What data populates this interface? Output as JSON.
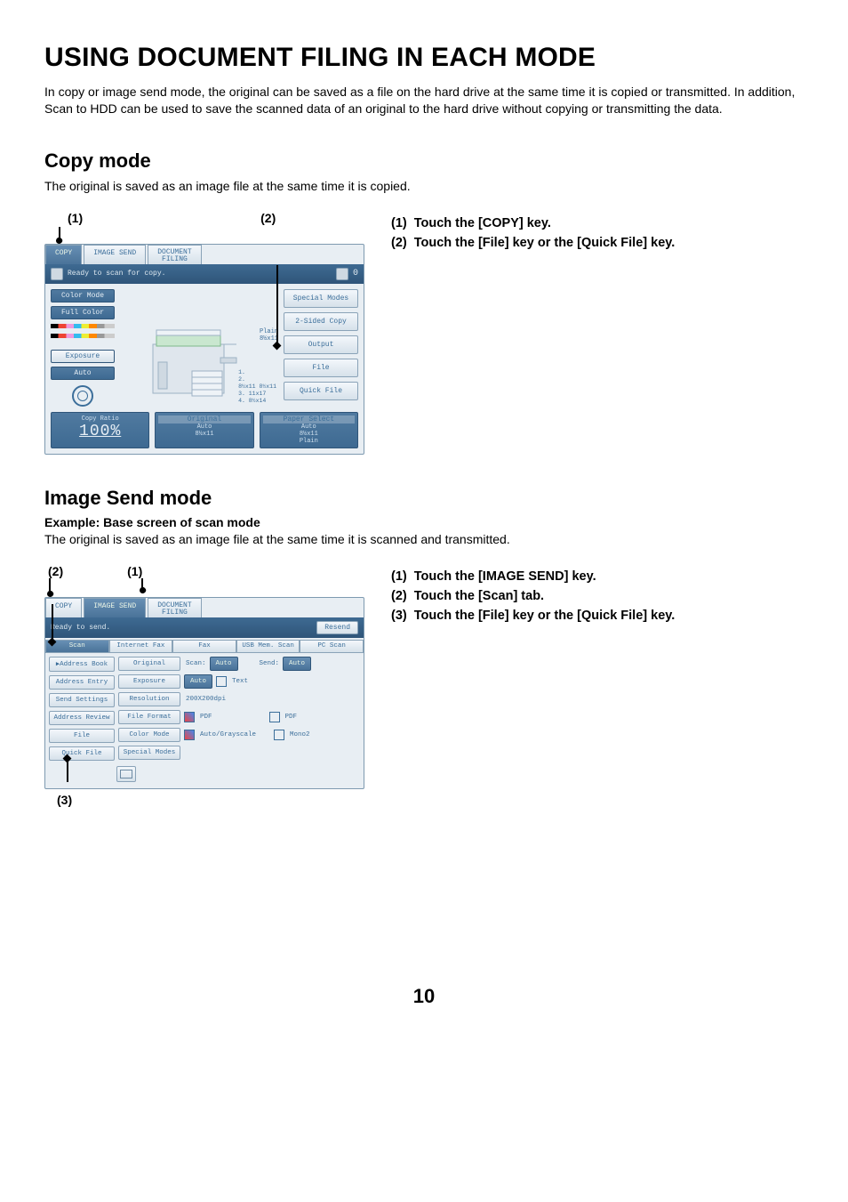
{
  "page": {
    "title": "USING DOCUMENT FILING IN EACH MODE",
    "intro": "In copy or image send mode, the original can be saved as a file on the hard drive at the same time it is copied or transmitted. In addition, Scan to HDD can be used to save the scanned data of an original to the hard drive without copying or transmitting the data.",
    "number": "10"
  },
  "copy": {
    "heading": "Copy mode",
    "description": "The original is saved as an image file at the same time it is copied.",
    "callout1": "(1)",
    "callout2": "(2)",
    "step1_num": "(1)",
    "step1_text": "Touch the [COPY] key.",
    "step2_num": "(2)",
    "step2_text": "Touch the [File] key or the [Quick File] key.",
    "screen": {
      "tabs": {
        "copy": "COPY",
        "image_send": "IMAGE SEND",
        "doc_filing": "DOCUMENT\nFILING"
      },
      "status": "Ready to scan for copy.",
      "status_count": "0",
      "left": {
        "color_mode_label": "Color Mode",
        "color_mode_value": "Full Color",
        "exposure_label": "Exposure",
        "exposure_value": "Auto"
      },
      "tray_top": {
        "plain": "Plain",
        "size": "8½x11"
      },
      "trays": {
        "t1": "1.    ",
        "t2": "2.    ",
        "t3": "8½x11 8½x11",
        "t4": "3. 11x17 ",
        "t5": "4. 8½x14 "
      },
      "right_buttons": {
        "special_modes": "Special Modes",
        "two_sided": "2-Sided Copy",
        "output": "Output",
        "file": "File",
        "quick_file": "Quick File"
      },
      "footer": {
        "copy_ratio_label": "Copy Ratio",
        "copy_ratio_value": "100%",
        "original_label": "Original",
        "original_value": "Auto",
        "original_size": "8½x11",
        "paper_select_label": "Paper Select",
        "paper_select_value": "Auto",
        "paper_select_size": "8½x11",
        "paper_select_type": "Plain"
      }
    }
  },
  "send": {
    "heading": "Image Send mode",
    "example_label": "Example: Base screen of scan mode",
    "description": "The original is saved as an image file at the same time it is scanned and transmitted.",
    "callout1": "(1)",
    "callout2": "(2)",
    "callout3": "(3)",
    "step1_num": "(1)",
    "step1_text": "Touch the [IMAGE SEND] key.",
    "step2_num": "(2)",
    "step2_text": "Touch the [Scan] tab.",
    "step3_num": "(3)",
    "step3_text": "Touch the [File] key or the [Quick File] key.",
    "screen": {
      "tabs": {
        "copy": "COPY",
        "image_send": "IMAGE SEND",
        "doc_filing": "DOCUMENT\nFILING"
      },
      "status": "Ready to send.",
      "resend": "Resend",
      "scan_tabs": {
        "scan": "Scan",
        "internet_fax": "Internet Fax",
        "fax": "Fax",
        "usb_mem": "USB Mem. Scan",
        "pc_scan": "PC Scan"
      },
      "left_buttons": {
        "address_book": "Address Book",
        "address_entry": "Address Entry",
        "send_settings": "Send Settings",
        "address_review": "Address Review",
        "file": "File",
        "quick_file": "Quick File"
      },
      "rows": {
        "original_label": "Original",
        "scan_label": "Scan:",
        "scan_value": "Auto",
        "send_label": "Send:",
        "send_value": "Auto",
        "exposure_label": "Exposure",
        "exposure_value": "Auto",
        "exposure_text": "Text",
        "resolution_label": "Resolution",
        "resolution_value": "200X200dpi",
        "file_format_label": "File Format",
        "file_format_pdf1": "PDF",
        "file_format_pdf2": "PDF",
        "color_mode_label": "Color Mode",
        "color_mode_value1": "Auto/Grayscale",
        "color_mode_value2": "Mono2",
        "special_modes_label": "Special Modes"
      }
    }
  }
}
